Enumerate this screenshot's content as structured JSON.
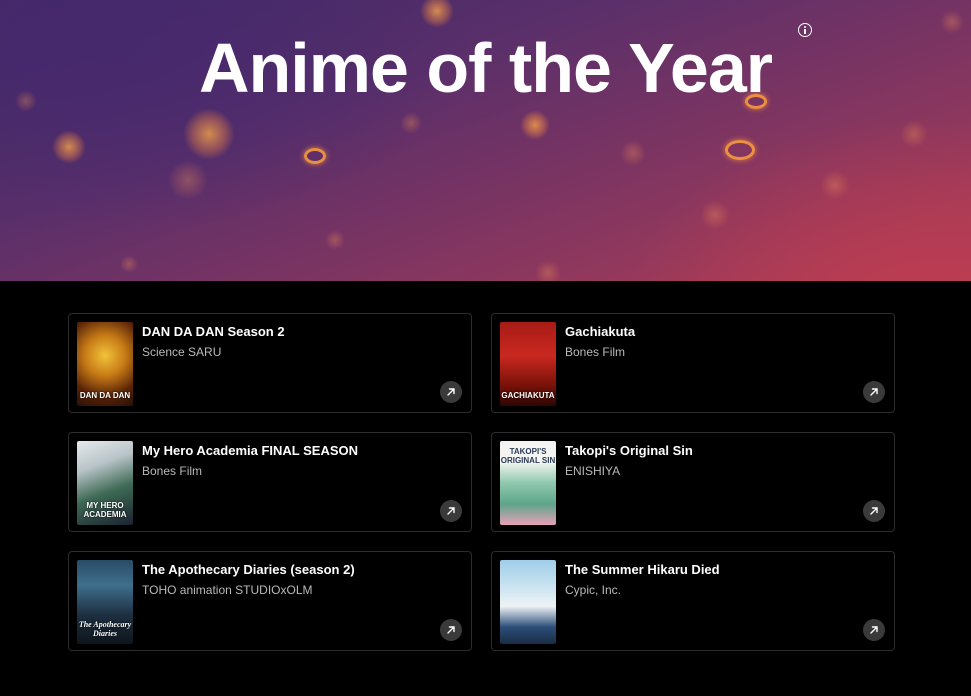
{
  "hero": {
    "title": "Anime of the Year",
    "info_icon": "info-icon"
  },
  "cards": [
    {
      "title": "DAN DA DAN Season 2",
      "studio": "Science SARU",
      "poster_caption": "DAN DA DAN",
      "poster_colors": [
        "#3a1d08",
        "#e3a21f",
        "#6b2a10"
      ]
    },
    {
      "title": "Gachiakuta",
      "studio": "Bones Film",
      "poster_caption": "GACHIAKUTA",
      "poster_colors": [
        "#8c1410",
        "#c3241c",
        "#3b0806"
      ]
    },
    {
      "title": "My Hero Academia FINAL SEASON",
      "studio": "Bones Film",
      "poster_caption": "MY HERO ACADEMIA",
      "poster_colors": [
        "#d9dde0",
        "#2e5a45",
        "#1a1f2a"
      ]
    },
    {
      "title": "Takopi's Original Sin",
      "studio": "ENISHIYA",
      "poster_caption": "TAKOPI'S ORIGINAL SIN",
      "poster_colors": [
        "#f1f3ef",
        "#6fb59a",
        "#e48aa8"
      ]
    },
    {
      "title": "The Apothecary Diaries (season 2)",
      "studio": "TOHO animation STUDIOxOLM",
      "poster_caption": "The Apothecary Diaries",
      "poster_colors": [
        "#1b2a3a",
        "#3f6a86",
        "#101820"
      ]
    },
    {
      "title": "The Summer Hikaru Died",
      "studio": "Cypic, Inc.",
      "poster_caption": "",
      "poster_colors": [
        "#a7cfe8",
        "#eef4f6",
        "#1f3f66"
      ]
    }
  ],
  "icons": {
    "open": "arrow-up-right-icon"
  }
}
